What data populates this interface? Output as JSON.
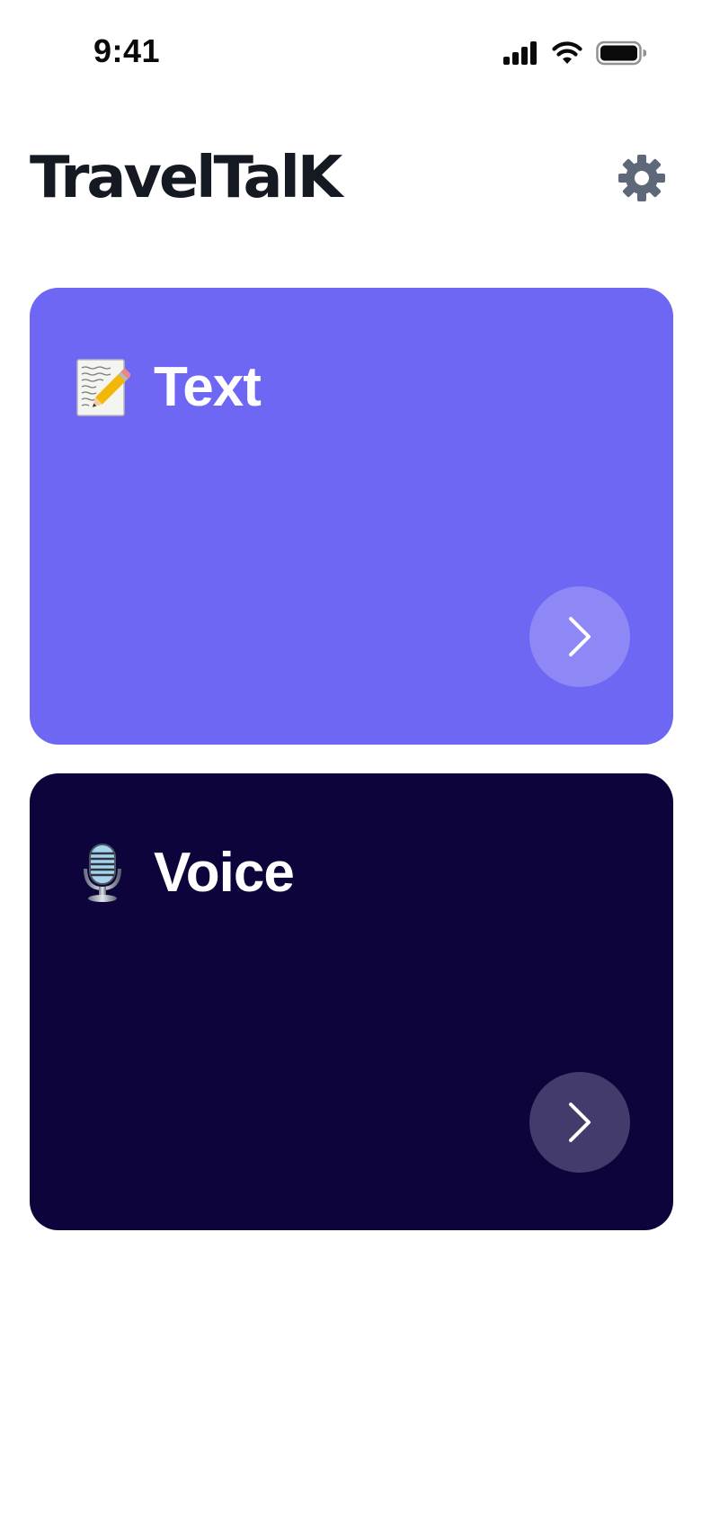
{
  "status_bar": {
    "time": "9:41",
    "icons": [
      "signal-icon",
      "wifi-icon",
      "battery-icon"
    ]
  },
  "header": {
    "title": "TravelTalK",
    "settings_icon": "gear-icon"
  },
  "cards": [
    {
      "id": "text",
      "label": "Text",
      "emoji": "memo-icon",
      "background": "#6e67f3",
      "arrow_background": "#8e87f6",
      "arrow_icon": "chevron-right-icon"
    },
    {
      "id": "voice",
      "label": "Voice",
      "emoji": "microphone-icon",
      "background": "#0d043c",
      "arrow_background": "#433b6b",
      "arrow_icon": "chevron-right-icon"
    }
  ],
  "colors": {
    "page_background": "#ffffff",
    "title_color": "#151a22",
    "gear_color": "#5e6878",
    "card_text_color": "#ffffff"
  }
}
